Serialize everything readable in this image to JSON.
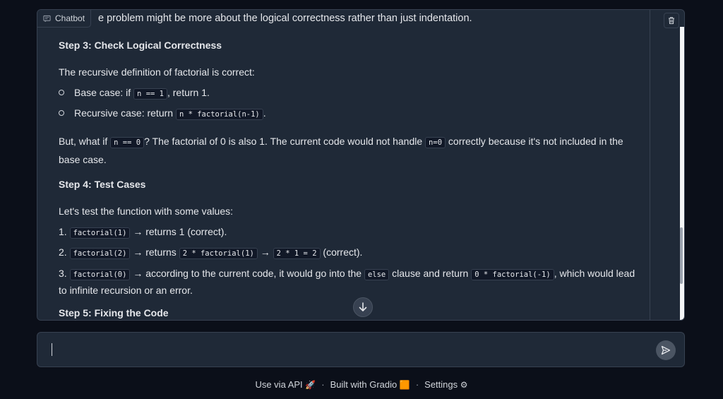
{
  "chatbot": {
    "label": "Chatbot",
    "lead_text": "e problem might be more about the logical correctness rather than just indentation.",
    "step3_title": "Step 3: Check Logical Correctness",
    "step3_intro": "The recursive definition of factorial is correct:",
    "base_case_prefix": "Base case: if ",
    "base_case_code": "n == 1",
    "base_case_suffix": ", return 1.",
    "recursive_prefix": "Recursive case: return ",
    "recursive_code": "n * factorial(n-1)",
    "recursive_suffix": ".",
    "but_prefix": "But, what if ",
    "but_code1": "n == 0",
    "but_mid": "? The factorial of 0 is also 1. The current code would not handle ",
    "but_code2": "n=0",
    "but_suffix": " correctly because it's not included in the base case.",
    "step4_title": "Step 4: Test Cases",
    "step4_intro": "Let's test the function with some values:",
    "test1_num": "1.",
    "test1_code": "factorial(1)",
    "test1_text": " → returns 1 (correct).",
    "test2_num": "2.",
    "test2_code": "factorial(2)",
    "test2_mid": " → returns ",
    "test2_code2": "2 * factorial(1)",
    "test2_arrow": " → ",
    "test2_code3": "2 * 1 = 2",
    "test2_end": " (correct).",
    "test3_num": "3.",
    "test3_code": "factorial(0)",
    "test3_mid": " → according to the current code, it would go into the ",
    "test3_code2": "else",
    "test3_mid2": " clause and return ",
    "test3_code3": "0 * factorial(-1)",
    "test3_end": ", which would lead to infinite recursion or an error.",
    "step5_title": "Step 5: Fixing the Code"
  },
  "input": {
    "placeholder": ""
  },
  "footer": {
    "api_label": "Use via API",
    "api_emoji": "🚀",
    "gradio_label": "Built with Gradio",
    "gradio_emoji": "🟧",
    "settings_label": "Settings",
    "settings_emoji": "⚙",
    "separator": "·"
  },
  "colors": {
    "background": "#0b0f19",
    "panel": "#1f2937",
    "border": "#374151",
    "text": "#e5e7eb"
  }
}
